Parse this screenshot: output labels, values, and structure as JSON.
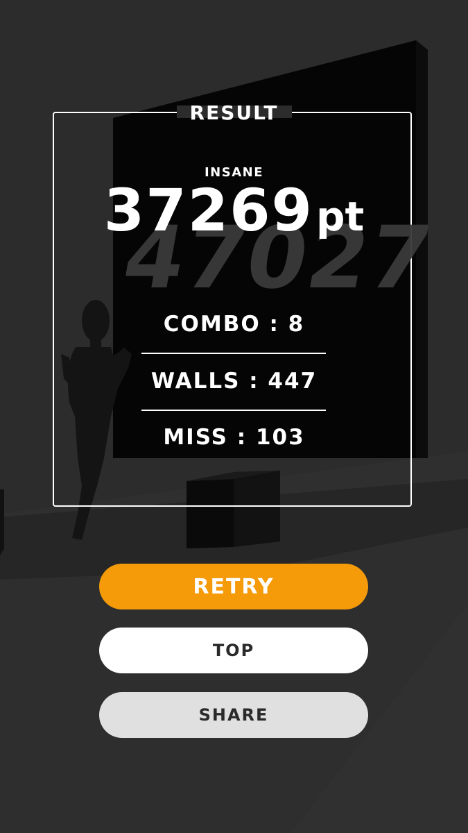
{
  "result": {
    "title": "RESULT",
    "difficulty": "INSANE",
    "score": "37269",
    "score_unit": "pt",
    "ghost_score": "47027",
    "combo": "COMBO : 8",
    "walls": "WALLS : 447",
    "miss": "MISS : 103"
  },
  "buttons": {
    "retry": "RETRY",
    "top": "TOP",
    "share": "SHARE"
  },
  "colors": {
    "background": "#2b2b2b",
    "wall": "#050505",
    "accent": "#f59a09",
    "panel_border": "#ffffff",
    "ghost_score": "#3a3a3a"
  }
}
